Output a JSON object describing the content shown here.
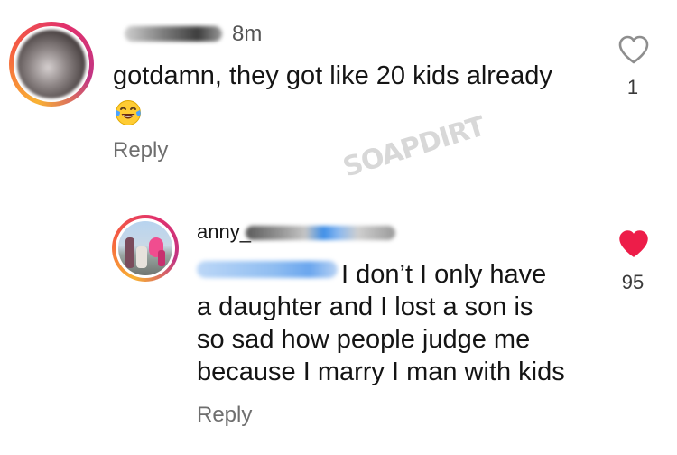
{
  "comments": [
    {
      "time": "8m",
      "text": "gotdamn, they got like 20 kids already",
      "emoji_icon": "face-with-tears-of-joy-icon",
      "reply_label": "Reply",
      "likes": "1",
      "liked": false
    },
    {
      "username": "anny_",
      "text_lines": [
        "I don’t I only have",
        "a daughter and I lost a son is",
        "so sad how people judge me",
        "because I marry I man with kids"
      ],
      "reply_label": "Reply",
      "likes": "95",
      "liked": true
    }
  ],
  "watermark": "SOAPDIRT",
  "colors": {
    "heart_liked": "#ed1d49",
    "heart_outline": "#8e8e8e",
    "muted_text": "#6e6e6e",
    "avatar_ring": [
      "#f9b233",
      "#f56040",
      "#e1306c",
      "#c13584"
    ]
  }
}
